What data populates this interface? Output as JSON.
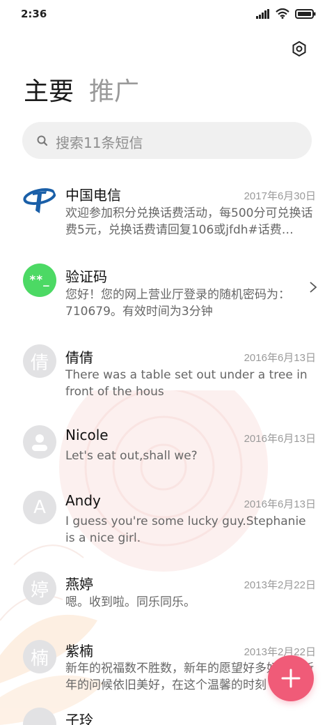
{
  "status": {
    "time": "2:36"
  },
  "tabs": [
    {
      "label": "主要"
    },
    {
      "label": "推广"
    }
  ],
  "search": {
    "placeholder": "搜索11条短信"
  },
  "conversations": [
    {
      "name": "中国电信",
      "date": "2017年6月30日",
      "preview": "欢迎参加积分兑换话费活动，每500分可兑换话费5元，兑换话费请回复106或jfdh#话费…",
      "avatar": "china-telecom-logo"
    },
    {
      "name": "验证码",
      "date": "",
      "preview": "您好！您的网上营业厅登录的随机密码为：710679。有效时间为3分钟",
      "avatar_text": "**_"
    },
    {
      "name": "倩倩",
      "date": "2016年6月13日",
      "preview": "There was a table set out under a tree in front of the hous",
      "avatar_text": "倩"
    },
    {
      "name": "Nicole",
      "date": "2016年6月13日",
      "preview": "Let's eat out,shall we?",
      "avatar": "person-icon"
    },
    {
      "name": "Andy",
      "date": "2016年6月13日",
      "preview": "I guess you're some lucky guy.Stephanie is a nice girl.",
      "avatar_text": "A"
    },
    {
      "name": "燕婷",
      "date": "2013年2月22日",
      "preview": "嗯。收到啦。同乐同乐。",
      "avatar_text": "婷"
    },
    {
      "name": "紫楠",
      "date": "2013年2月22日",
      "preview": "新年的祝福数不胜数，新年的愿望好多好多，新年的问候依旧美好，在这个温馨的时刻",
      "avatar_text": "楠"
    },
    {
      "name": "子玲",
      "date": "",
      "preview": "",
      "avatar_text": ""
    }
  ],
  "colors": {
    "accent": "#f05b78",
    "telecom_blue": "#1a5fa8",
    "verify_green": "#4cd964"
  }
}
